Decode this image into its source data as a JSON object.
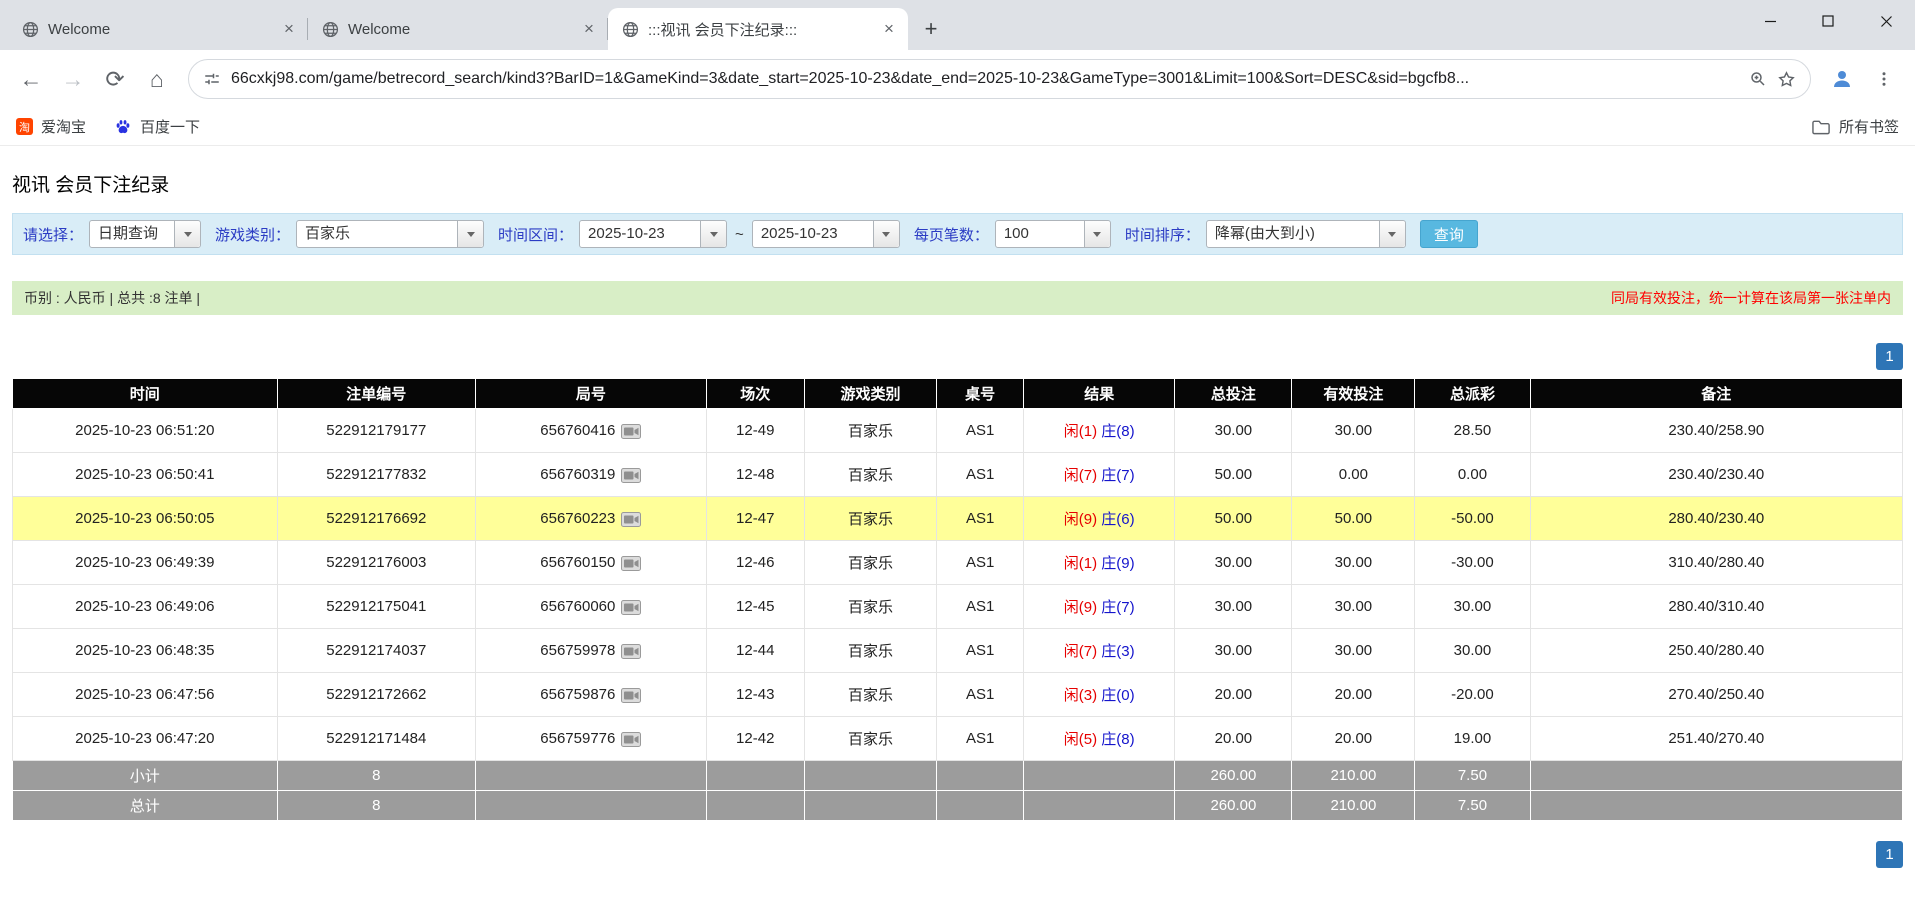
{
  "colors": {
    "pagination_active": "#2e75b6",
    "highlight_row": "#ffff99",
    "negative_value": "#ff0000",
    "total_bet_link": "#0066cc",
    "player_win_red": "#e60000",
    "banker_win_blue": "#1414cc",
    "filter_bar_bg": "#d9edf7",
    "info_bar_bg": "#d8eec6",
    "search_button_bg": "#58b8e0"
  },
  "browser": {
    "tabs": [
      {
        "title": "Welcome",
        "active": false
      },
      {
        "title": "Welcome",
        "active": false
      },
      {
        "title": ":::视讯 会员下注纪录:::",
        "active": true
      }
    ],
    "url": "66cxkj98.com/game/betrecord_search/kind3?BarID=1&GameKind=3&date_start=2025-10-23&date_end=2025-10-23&GameType=3001&Limit=100&Sort=DESC&sid=bgcfb8...",
    "bookmarks": [
      {
        "label": "爱淘宝",
        "icon": "taobao-icon"
      },
      {
        "label": "百度一下",
        "icon": "baidu-paw-icon"
      }
    ],
    "all_bookmarks_label": "所有书签"
  },
  "page": {
    "title": "视讯 会员下注纪录",
    "filters": {
      "select_label": "请选择：",
      "select_value": "日期查询",
      "game_type_label": "游戏类别：",
      "game_type_value": "百家乐",
      "date_range_label": "时间区间：",
      "date_start": "2025-10-23",
      "date_separator": "~",
      "date_end": "2025-10-23",
      "page_size_label": "每页笔数：",
      "page_size_value": "100",
      "sort_label": "时间排序：",
      "sort_value": "降幂(由大到小)",
      "search_button": "查询"
    },
    "info_bar": {
      "left": "币别 : 人民币 | 总共 :8 注单 |",
      "right": "同局有效投注，统一计算在该局第一张注单内"
    },
    "pagination": "1",
    "table": {
      "headers": [
        "时间",
        "注单编号",
        "局号",
        "场次",
        "游戏类别",
        "桌号",
        "结果",
        "总投注",
        "有效投注",
        "总派彩",
        "备注"
      ],
      "rows": [
        {
          "time": "2025-10-23 06:51:20",
          "bet_id": "522912179177",
          "round": "656760416",
          "session": "12-49",
          "game": "百家乐",
          "table_no": "AS1",
          "result_player": "闲(1)",
          "result_banker": "庄(8)",
          "total_bet": "30.00",
          "valid_bet": "30.00",
          "payout": "28.50",
          "remark": "230.40/258.90",
          "highlighted": false
        },
        {
          "time": "2025-10-23 06:50:41",
          "bet_id": "522912177832",
          "round": "656760319",
          "session": "12-48",
          "game": "百家乐",
          "table_no": "AS1",
          "result_player": "闲(7)",
          "result_banker": "庄(7)",
          "total_bet": "50.00",
          "valid_bet": "0.00",
          "payout": "0.00",
          "remark": "230.40/230.40",
          "highlighted": false
        },
        {
          "time": "2025-10-23 06:50:05",
          "bet_id": "522912176692",
          "round": "656760223",
          "session": "12-47",
          "game": "百家乐",
          "table_no": "AS1",
          "result_player": "闲(9)",
          "result_banker": "庄(6)",
          "total_bet": "50.00",
          "valid_bet": "50.00",
          "payout": "-50.00",
          "remark": "280.40/230.40",
          "highlighted": true
        },
        {
          "time": "2025-10-23 06:49:39",
          "bet_id": "522912176003",
          "round": "656760150",
          "session": "12-46",
          "game": "百家乐",
          "table_no": "AS1",
          "result_player": "闲(1)",
          "result_banker": "庄(9)",
          "total_bet": "30.00",
          "valid_bet": "30.00",
          "payout": "-30.00",
          "remark": "310.40/280.40",
          "highlighted": false
        },
        {
          "time": "2025-10-23 06:49:06",
          "bet_id": "522912175041",
          "round": "656760060",
          "session": "12-45",
          "game": "百家乐",
          "table_no": "AS1",
          "result_player": "闲(9)",
          "result_banker": "庄(7)",
          "total_bet": "30.00",
          "valid_bet": "30.00",
          "payout": "30.00",
          "remark": "280.40/310.40",
          "highlighted": false
        },
        {
          "time": "2025-10-23 06:48:35",
          "bet_id": "522912174037",
          "round": "656759978",
          "session": "12-44",
          "game": "百家乐",
          "table_no": "AS1",
          "result_player": "闲(7)",
          "result_banker": "庄(3)",
          "total_bet": "30.00",
          "valid_bet": "30.00",
          "payout": "30.00",
          "remark": "250.40/280.40",
          "highlighted": false
        },
        {
          "time": "2025-10-23 06:47:56",
          "bet_id": "522912172662",
          "round": "656759876",
          "session": "12-43",
          "game": "百家乐",
          "table_no": "AS1",
          "result_player": "闲(3)",
          "result_banker": "庄(0)",
          "total_bet": "20.00",
          "valid_bet": "20.00",
          "payout": "-20.00",
          "remark": "270.40/250.40",
          "highlighted": false
        },
        {
          "time": "2025-10-23 06:47:20",
          "bet_id": "522912171484",
          "round": "656759776",
          "session": "12-42",
          "game": "百家乐",
          "table_no": "AS1",
          "result_player": "闲(5)",
          "result_banker": "庄(8)",
          "total_bet": "20.00",
          "valid_bet": "20.00",
          "payout": "19.00",
          "remark": "251.40/270.40",
          "highlighted": false
        }
      ],
      "subtotal": {
        "label": "小计",
        "count": "8",
        "total_bet": "260.00",
        "valid_bet": "210.00",
        "payout": "7.50"
      },
      "total": {
        "label": "总计",
        "count": "8",
        "total_bet": "260.00",
        "valid_bet": "210.00",
        "payout": "7.50"
      }
    }
  }
}
